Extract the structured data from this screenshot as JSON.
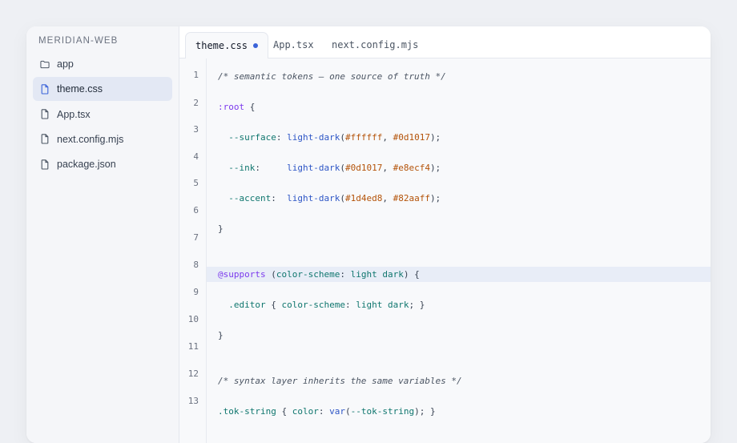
{
  "sidebar": {
    "project_title": "MERIDIAN-WEB",
    "items": [
      {
        "label": "app",
        "icon": "folder-icon",
        "active": false
      },
      {
        "label": "theme.css",
        "icon": "file-icon",
        "active": true
      },
      {
        "label": "App.tsx",
        "icon": "file-icon",
        "active": false
      },
      {
        "label": "next.config.mjs",
        "icon": "file-icon",
        "active": false
      },
      {
        "label": "package.json",
        "icon": "file-icon",
        "active": false
      }
    ]
  },
  "tabs": [
    {
      "label": "theme.css",
      "active": true,
      "modified": true
    },
    {
      "label": "App.tsx",
      "active": false
    },
    {
      "label": "next.config.mjs",
      "active": false
    }
  ],
  "editor": {
    "highlighted_line": 8,
    "line_numbers": [
      "1",
      "2",
      "3",
      "4",
      "5",
      "6",
      "7",
      "8",
      "9",
      "10",
      "11",
      "12",
      "13"
    ],
    "lines": [
      [
        {
          "t": "/* semantic tokens — one source of truth */",
          "c": "comment"
        }
      ],
      [
        {
          "t": ":root",
          "c": "sel"
        },
        {
          "t": " {",
          "c": "punc"
        }
      ],
      [
        {
          "t": "  --surface",
          "c": "prop"
        },
        {
          "t": ": ",
          "c": "punc"
        },
        {
          "t": "light-dark",
          "c": "fn"
        },
        {
          "t": "(",
          "c": "punc"
        },
        {
          "t": "#ffffff",
          "c": "hex"
        },
        {
          "t": ", ",
          "c": "punc"
        },
        {
          "t": "#0d1017",
          "c": "hex"
        },
        {
          "t": ");",
          "c": "punc"
        }
      ],
      [
        {
          "t": "  --ink",
          "c": "prop"
        },
        {
          "t": ":     ",
          "c": "punc"
        },
        {
          "t": "light-dark",
          "c": "fn"
        },
        {
          "t": "(",
          "c": "punc"
        },
        {
          "t": "#0d1017",
          "c": "hex"
        },
        {
          "t": ", ",
          "c": "punc"
        },
        {
          "t": "#e8ecf4",
          "c": "hex"
        },
        {
          "t": ");",
          "c": "punc"
        }
      ],
      [
        {
          "t": "  --accent",
          "c": "prop"
        },
        {
          "t": ":  ",
          "c": "punc"
        },
        {
          "t": "light-dark",
          "c": "fn"
        },
        {
          "t": "(",
          "c": "punc"
        },
        {
          "t": "#1d4ed8",
          "c": "hex"
        },
        {
          "t": ", ",
          "c": "punc"
        },
        {
          "t": "#82aaff",
          "c": "hex"
        },
        {
          "t": ");",
          "c": "punc"
        }
      ],
      [
        {
          "t": "}",
          "c": "punc"
        }
      ],
      [],
      [
        {
          "t": "@supports",
          "c": "at"
        },
        {
          "t": " (",
          "c": "punc"
        },
        {
          "t": "color-scheme",
          "c": "kw"
        },
        {
          "t": ": ",
          "c": "punc"
        },
        {
          "t": "light dark",
          "c": "kw"
        },
        {
          "t": ") {",
          "c": "punc"
        }
      ],
      [
        {
          "t": "  .editor",
          "c": "sel2"
        },
        {
          "t": " { ",
          "c": "punc"
        },
        {
          "t": "color-scheme",
          "c": "kw"
        },
        {
          "t": ": ",
          "c": "punc"
        },
        {
          "t": "light dark",
          "c": "kw"
        },
        {
          "t": "; }",
          "c": "punc"
        }
      ],
      [
        {
          "t": "}",
          "c": "punc"
        }
      ],
      [],
      [
        {
          "t": "/* syntax layer inherits the same variables */",
          "c": "comment"
        }
      ],
      [
        {
          "t": ".tok-string",
          "c": "sel2"
        },
        {
          "t": " { ",
          "c": "punc"
        },
        {
          "t": "color",
          "c": "kw"
        },
        {
          "t": ": ",
          "c": "punc"
        },
        {
          "t": "var",
          "c": "fn"
        },
        {
          "t": "(",
          "c": "punc"
        },
        {
          "t": "--tok-string",
          "c": "kw"
        },
        {
          "t": "); }",
          "c": "punc"
        }
      ]
    ]
  },
  "colors": {
    "accent": "#3b63d9",
    "background": "#eef0f4",
    "highlight": "#e8edf7"
  }
}
